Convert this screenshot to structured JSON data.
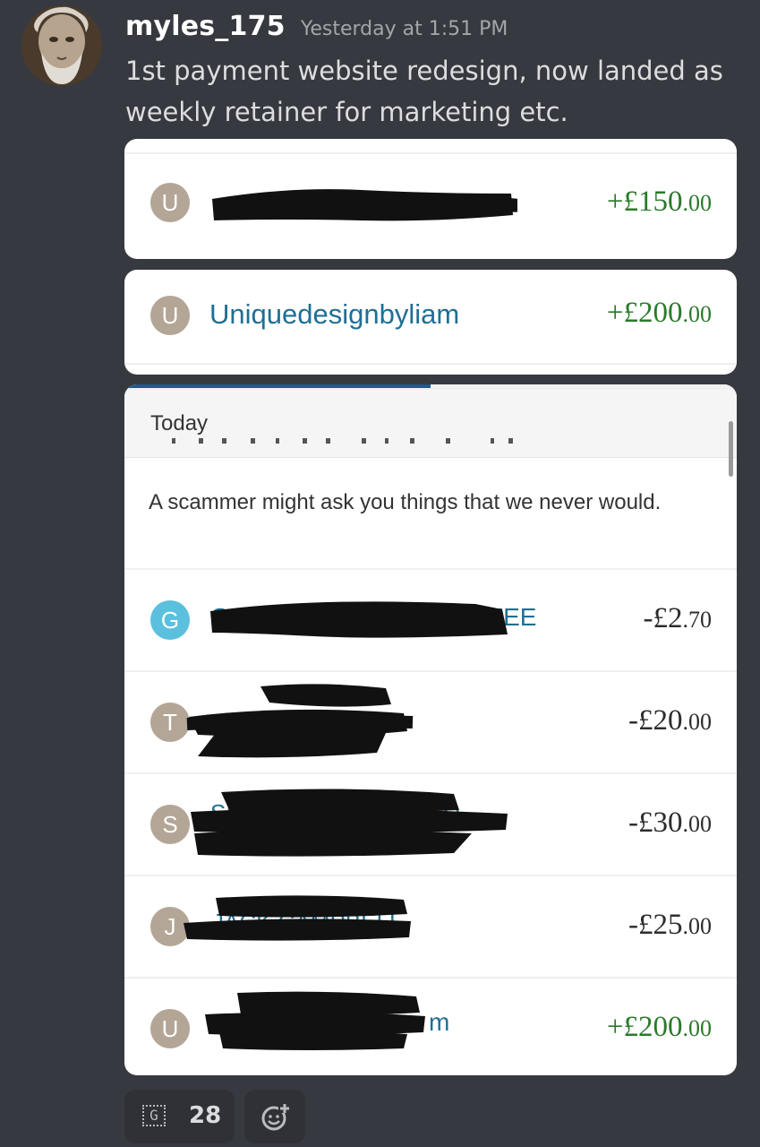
{
  "message": {
    "username": "myles_175",
    "timestamp": "Yesterday at 1:51 PM",
    "text": "1st payment website redesign, now landed as weekly retainer for marketing etc."
  },
  "card1": {
    "avatar_letter": "U",
    "amount_main": "+£150",
    "amount_pence": ".00"
  },
  "card2": {
    "avatar_letter": "U",
    "name": "Uniquedesignbyliam",
    "amount_main": "+£200",
    "amount_pence": ".00"
  },
  "card3": {
    "progress": 0.5,
    "section_label": "Today",
    "notice": "A scammer might ask you things that we never would.",
    "transactions": [
      {
        "letter": "G",
        "amount_main": "-£2",
        "amount_pence": ".70"
      },
      {
        "letter": "T",
        "amount_main": "-£20",
        "amount_pence": ".00"
      },
      {
        "letter": "S",
        "amount_main": "-£30",
        "amount_pence": ".00"
      },
      {
        "letter": "J",
        "amount_main": "-£25",
        "amount_pence": ".00"
      },
      {
        "letter": "U",
        "amount_main": "+£200",
        "amount_pence": ".00"
      }
    ]
  },
  "reactions": {
    "emoji_icon": "g-emoji-icon",
    "count": "28",
    "add_icon": "add-reaction-icon"
  },
  "colors": {
    "background": "#36393f",
    "positive_amount": "#2a7a2a",
    "negative_amount": "#2d2d2d",
    "payee_link": "#1f6f95"
  }
}
